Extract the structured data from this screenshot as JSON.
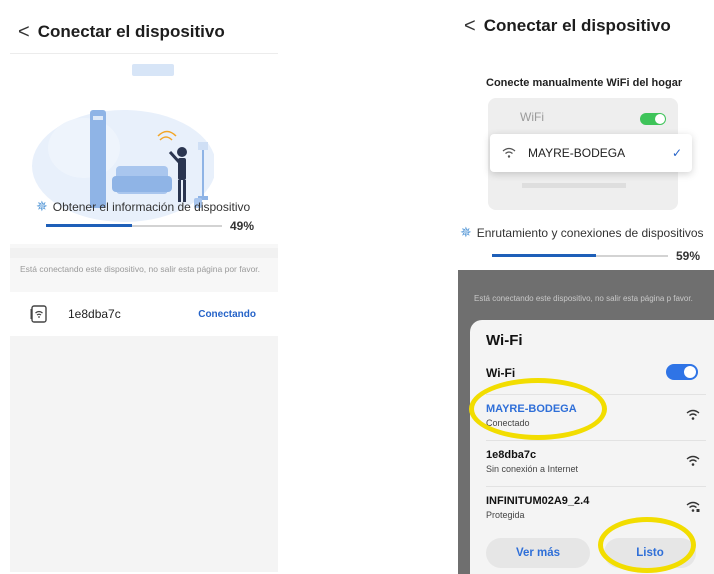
{
  "left_screen": {
    "back_glyph": "<",
    "title": "Conectar el dispositivo",
    "step_label": "Obtener el información de dispositivo",
    "progress_percent": 49,
    "progress_text": "49%",
    "notice": "Está conectando este dispositivo, no salir esta página por favor.",
    "device": {
      "name": "1e8dba7c",
      "status": "Conectando",
      "icon": "router-icon"
    }
  },
  "right_screen": {
    "back_glyph": "<",
    "title": "Conectar el dispositivo",
    "heading": "Conecte manualmente WiFi del hogar",
    "wifi_label": "WiFi",
    "selected_network": "MAYRE-BODEGA",
    "step_label": "Enrutamiento y conexiones de dispositivos",
    "progress_percent": 59,
    "progress_text": "59%",
    "notice": "Está conectando este dispositivo, no salir esta página p favor.",
    "wifi_sheet": {
      "title": "Wi-Fi",
      "toggle_label": "Wi-Fi",
      "toggle_on": true,
      "networks": [
        {
          "name": "MAYRE-BODEGA",
          "status": "Conectado",
          "active": true
        },
        {
          "name": "1e8dba7c",
          "status": "Sin conexión a Internet",
          "active": false
        },
        {
          "name": "INFINITUM02A9_2.4",
          "status": "Protegida",
          "active": false
        }
      ],
      "more_button": "Ver más",
      "done_button": "Listo"
    }
  },
  "colors": {
    "accent_blue": "#2f6fd8",
    "progress_blue": "#1e5fb8",
    "highlight_yellow": "#f2dd00",
    "toggle_green": "#3fc45a"
  }
}
